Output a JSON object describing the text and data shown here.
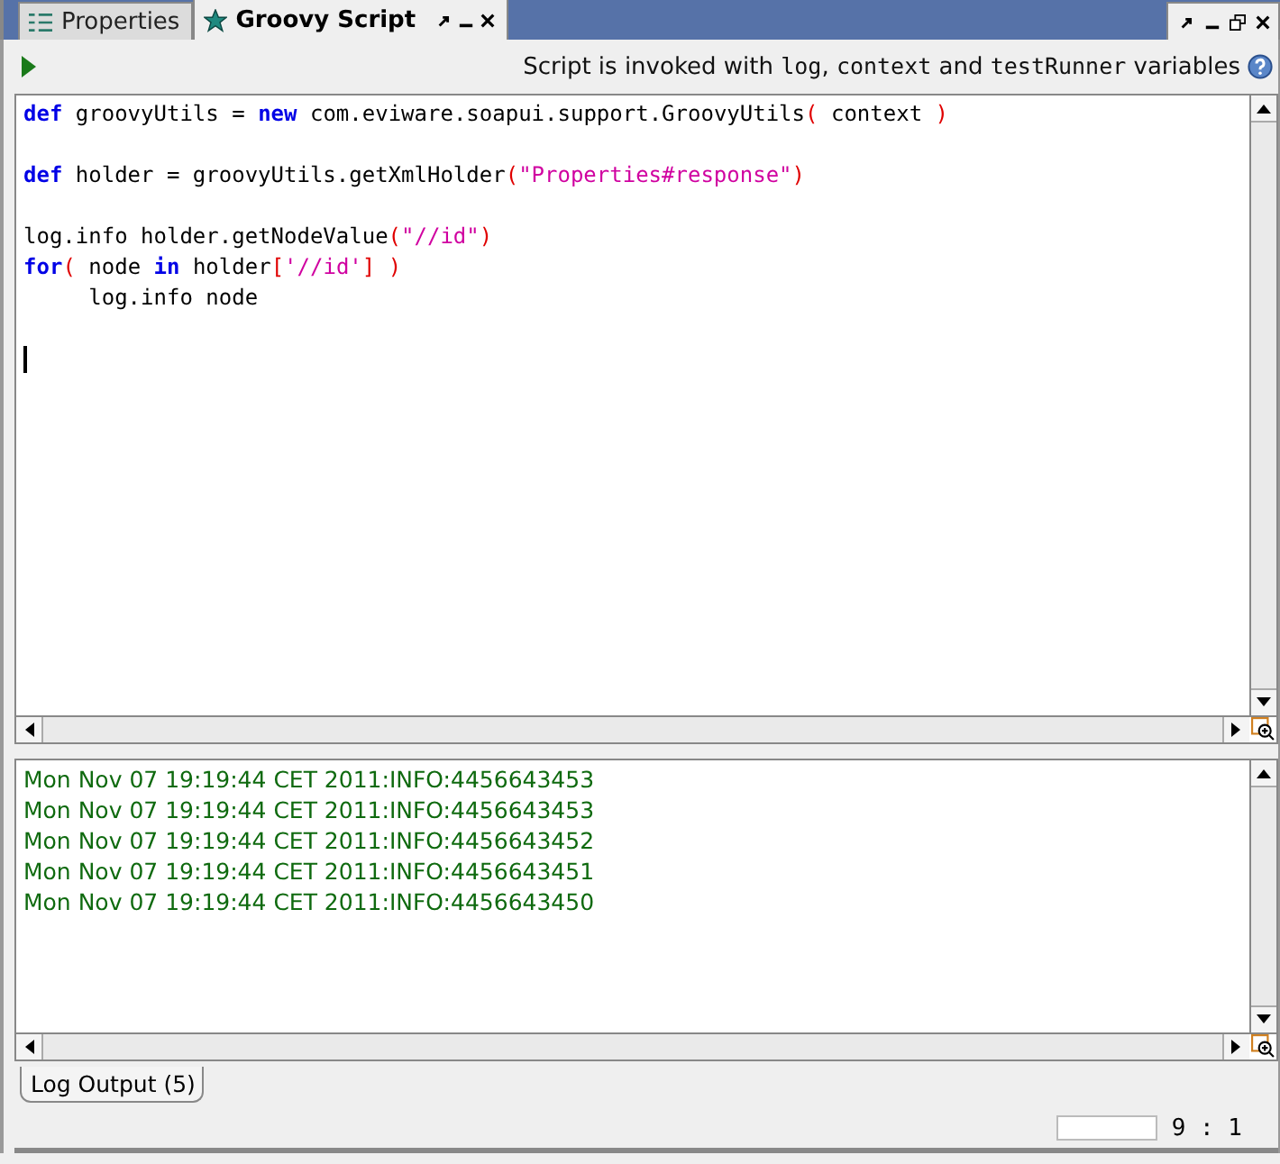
{
  "tabs": [
    {
      "label": "Properties",
      "selected": false
    },
    {
      "label": "Groovy Script",
      "selected": true
    }
  ],
  "toolbar": {
    "hint": [
      {
        "kind": "plain",
        "text": "Script is invoked with "
      },
      {
        "kind": "mono",
        "text": "log"
      },
      {
        "kind": "plain",
        "text": ", "
      },
      {
        "kind": "mono",
        "text": "context"
      },
      {
        "kind": "plain",
        "text": " and "
      },
      {
        "kind": "mono",
        "text": "testRunner"
      },
      {
        "kind": "plain",
        "text": " variables"
      }
    ]
  },
  "editor": {
    "lines": [
      {
        "kind": "code",
        "tokens": [
          {
            "kind": "keyword",
            "text": "def"
          },
          {
            "kind": "plain",
            "text": " groovyUtils = "
          },
          {
            "kind": "keyword",
            "text": "new"
          },
          {
            "kind": "plain",
            "text": " com.eviware.soapui.support.GroovyUtils"
          },
          {
            "kind": "paren",
            "text": "("
          },
          {
            "kind": "plain",
            "text": " context "
          },
          {
            "kind": "paren",
            "text": ")"
          }
        ]
      },
      {
        "kind": "blank"
      },
      {
        "kind": "code",
        "tokens": [
          {
            "kind": "keyword",
            "text": "def"
          },
          {
            "kind": "plain",
            "text": " holder = groovyUtils.getXmlHolder"
          },
          {
            "kind": "paren",
            "text": "("
          },
          {
            "kind": "string",
            "text": "\"Properties#response\""
          },
          {
            "kind": "paren",
            "text": ")"
          }
        ]
      },
      {
        "kind": "blank"
      },
      {
        "kind": "code",
        "tokens": [
          {
            "kind": "plain",
            "text": "log.info holder.getNodeValue"
          },
          {
            "kind": "paren",
            "text": "("
          },
          {
            "kind": "string",
            "text": "\"//id\""
          },
          {
            "kind": "paren",
            "text": ")"
          }
        ]
      },
      {
        "kind": "code",
        "tokens": [
          {
            "kind": "keyword",
            "text": "for"
          },
          {
            "kind": "paren",
            "text": "("
          },
          {
            "kind": "plain",
            "text": " node "
          },
          {
            "kind": "keyword",
            "text": "in"
          },
          {
            "kind": "plain",
            "text": " holder"
          },
          {
            "kind": "paren",
            "text": "["
          },
          {
            "kind": "string",
            "text": "'//id'"
          },
          {
            "kind": "paren",
            "text": "] )"
          }
        ]
      },
      {
        "kind": "code",
        "tokens": [
          {
            "kind": "plain",
            "text": "     log.info node"
          }
        ]
      },
      {
        "kind": "blank"
      },
      {
        "kind": "caret"
      }
    ]
  },
  "log": {
    "lines": [
      "Mon Nov 07 19:19:44 CET 2011:INFO:4456643453",
      "Mon Nov 07 19:19:44 CET 2011:INFO:4456643453",
      "Mon Nov 07 19:19:44 CET 2011:INFO:4456643452",
      "Mon Nov 07 19:19:44 CET 2011:INFO:4456643451",
      "Mon Nov 07 19:19:44 CET 2011:INFO:4456643450"
    ],
    "tab": "Log Output (5)"
  },
  "status_bar": {
    "position": "9 : 1"
  }
}
